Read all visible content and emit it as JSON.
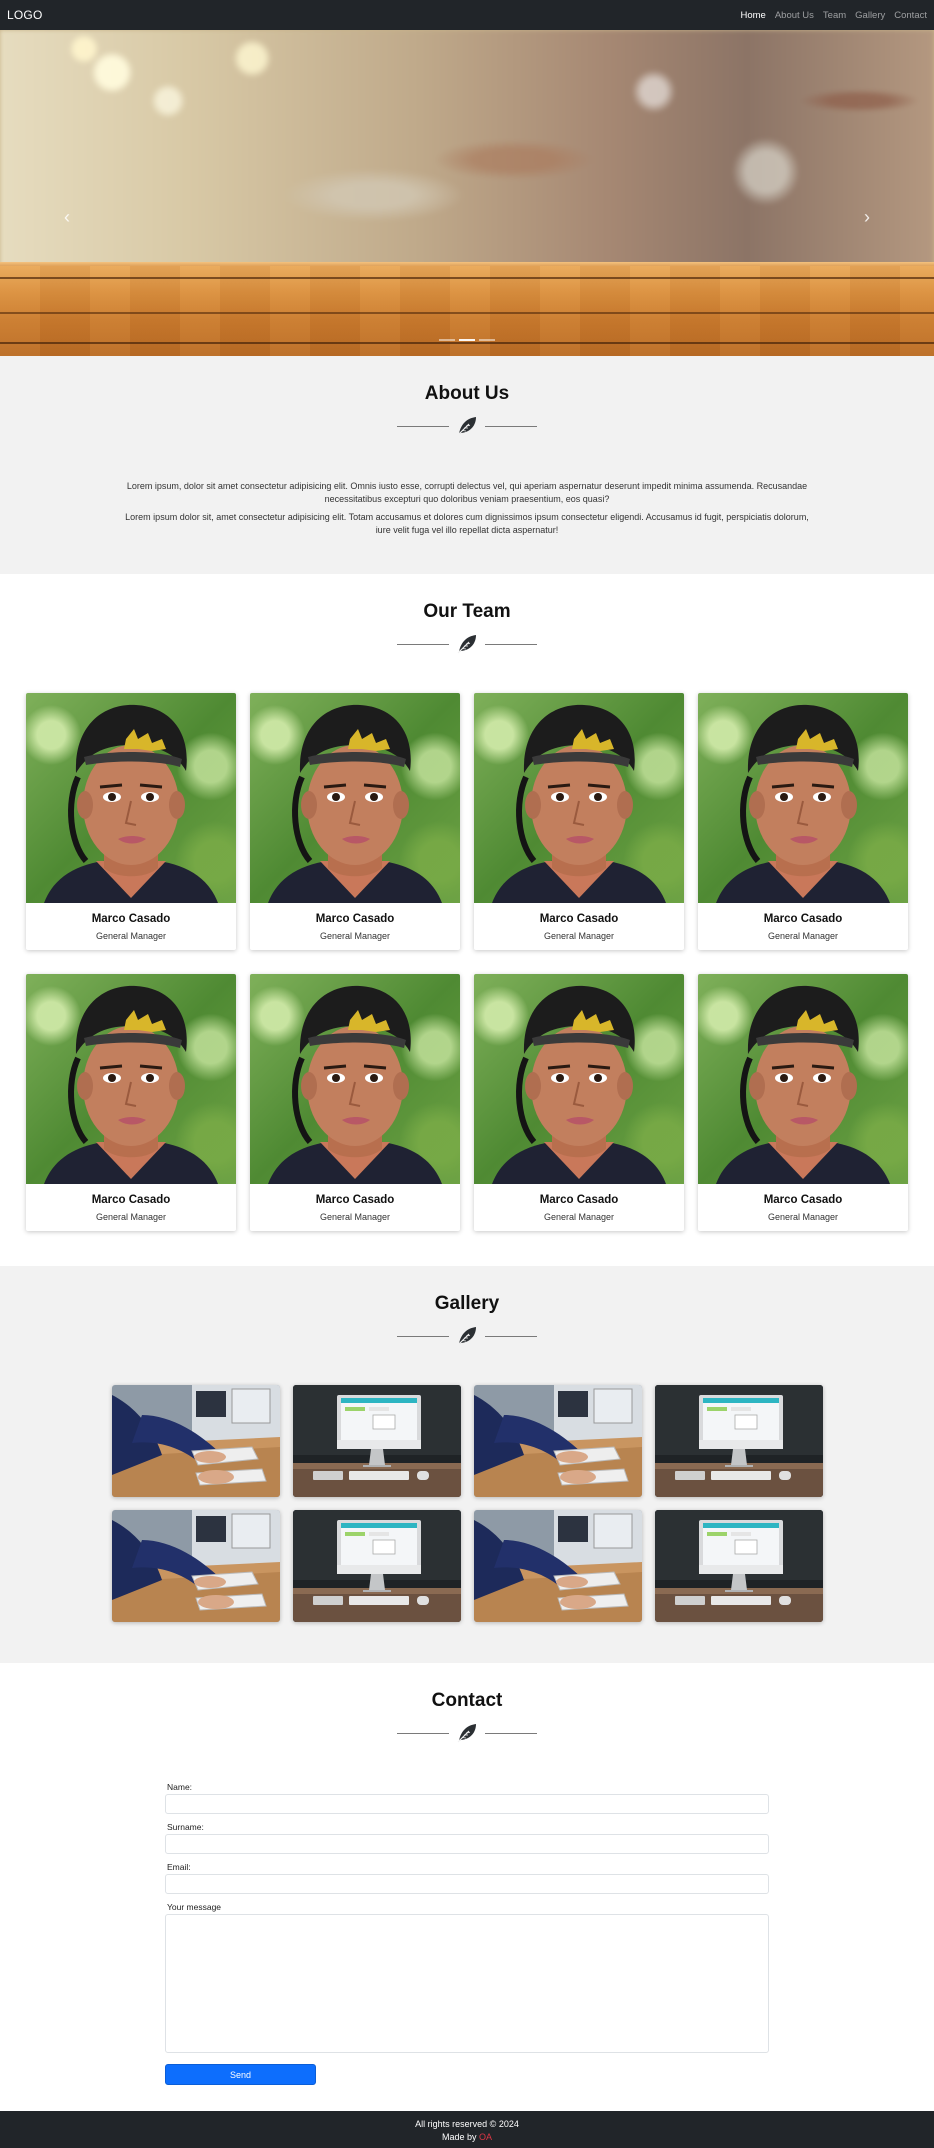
{
  "navbar": {
    "logo": "LOGO",
    "links": [
      {
        "label": "Home"
      },
      {
        "label": "About Us"
      },
      {
        "label": "Team"
      },
      {
        "label": "Gallery"
      },
      {
        "label": "Contact"
      }
    ],
    "active_link": "Home"
  },
  "hero": {
    "prev_glyph": "‹",
    "next_glyph": "›",
    "slide_count": 3,
    "active_slide": 2
  },
  "about": {
    "title": "About Us",
    "paragraphs": [
      "Lorem ipsum, dolor sit amet consectetur adipisicing elit. Omnis iusto esse, corrupti delectus vel, qui aperiam aspernatur deserunt impedit minima assumenda. Recusandae necessitatibus excepturi quo doloribus veniam praesentium, eos quasi?",
      "Lorem ipsum dolor sit, amet consectetur adipisicing elit. Totam accusamus et dolores cum dignissimos ipsum consectetur eligendi. Accusamus id fugit, perspiciatis dolorum, iure velit fuga vel illo repellat dicta aspernatur!"
    ]
  },
  "team": {
    "title": "Our Team",
    "members": [
      {
        "name": "Marco Casado",
        "role": "General Manager"
      },
      {
        "name": "Marco Casado",
        "role": "General Manager"
      },
      {
        "name": "Marco Casado",
        "role": "General Manager"
      },
      {
        "name": "Marco Casado",
        "role": "General Manager"
      },
      {
        "name": "Marco Casado",
        "role": "General Manager"
      },
      {
        "name": "Marco Casado",
        "role": "General Manager"
      },
      {
        "name": "Marco Casado",
        "role": "General Manager"
      },
      {
        "name": "Marco Casado",
        "role": "General Manager"
      }
    ]
  },
  "gallery": {
    "title": "Gallery",
    "images": [
      "desk-typing-photo",
      "desktop-computer-photo",
      "desk-typing-photo",
      "desktop-computer-photo",
      "desk-typing-photo",
      "desktop-computer-photo",
      "desk-typing-photo",
      "desktop-computer-photo"
    ]
  },
  "contact": {
    "title": "Contact",
    "name_label": "Name:",
    "surname_label": "Surname:",
    "email_label": "Email:",
    "message_label": "Your message",
    "send_label": "Send"
  },
  "footer": {
    "rights": "All rights reserved © 2024",
    "made_by_prefix": "Made by ",
    "author": "OA"
  },
  "colors": {
    "navbar_bg": "#212529",
    "section_gray": "#f2f2f2",
    "primary_button": "#0d6efd",
    "author_red": "#dc3545"
  },
  "icons": {
    "divider": "leaf-icon",
    "carousel_prev": "chevron-left-icon",
    "carousel_next": "chevron-right-icon"
  }
}
